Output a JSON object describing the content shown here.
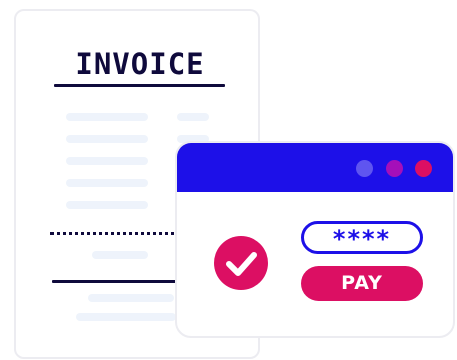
{
  "invoice": {
    "title": "INVOICE"
  },
  "payment": {
    "password_mask": "****",
    "pay_label": "PAY",
    "success_icon": "check-icon"
  },
  "colors": {
    "navy": "#0f0a3c",
    "blue": "#1d10e8",
    "magenta": "#dc0f63",
    "window_dot_1": "#5f55f0",
    "window_dot_2": "#a50fb9",
    "window_dot_3": "#dc0f63",
    "placeholder": "#eef3fb",
    "border": "#ececf1"
  }
}
